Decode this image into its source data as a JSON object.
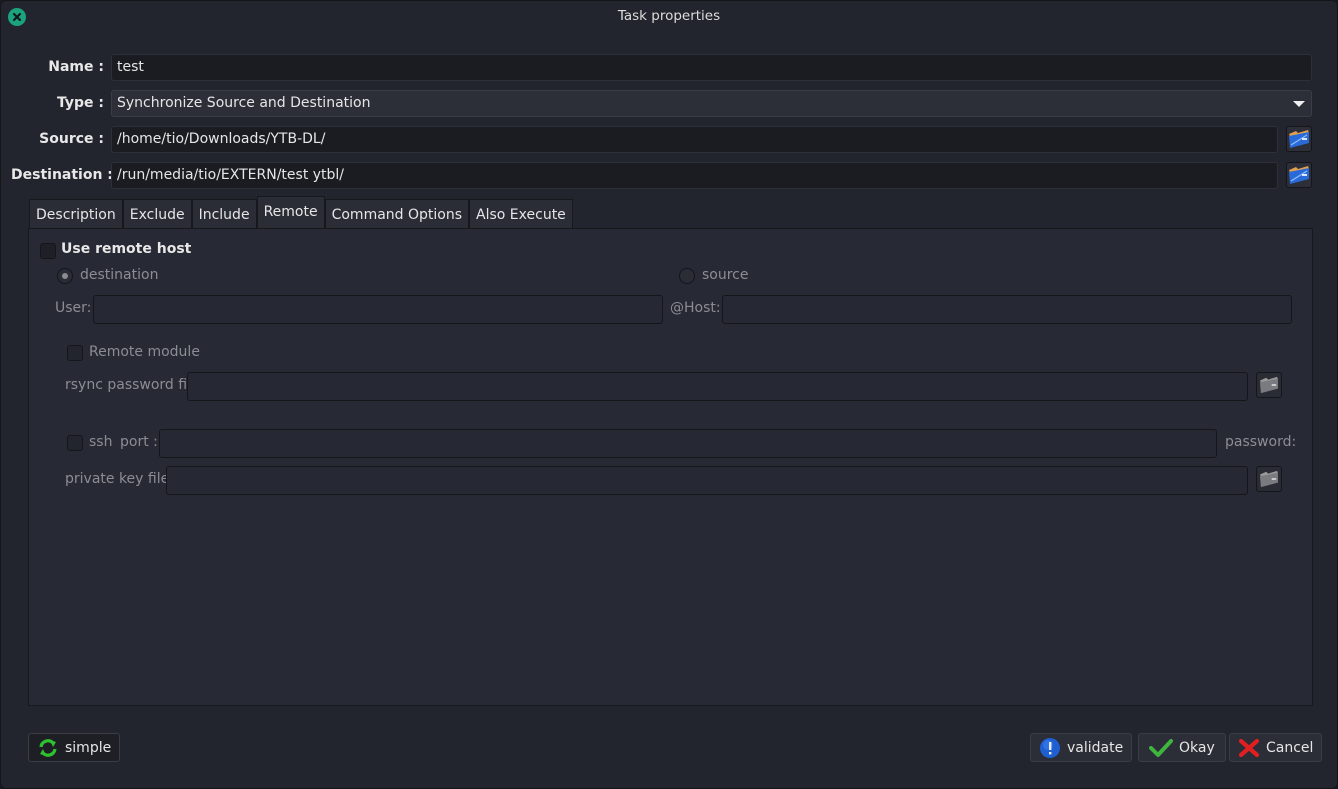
{
  "window": {
    "title": "Task properties",
    "close_icon": "close-icon"
  },
  "form": {
    "name_label": "Name :",
    "name_value": "test",
    "type_label": "Type :",
    "type_value": "Synchronize Source and Destination",
    "source_label": "Source :",
    "source_value": "/home/tio/Downloads/YTB-DL/",
    "destination_label": "Destination :",
    "destination_value": "/run/media/tio/EXTERN/test ytbl/"
  },
  "tabs": [
    {
      "label": "Description",
      "active": false
    },
    {
      "label": "Exclude",
      "active": false
    },
    {
      "label": "Include",
      "active": false
    },
    {
      "label": "Remote",
      "active": true
    },
    {
      "label": "Command Options",
      "active": false
    },
    {
      "label": "Also Execute",
      "active": false
    }
  ],
  "remote": {
    "use_remote_host_label": "Use remote host",
    "use_remote_host_checked": false,
    "radio_destination_label": "destination",
    "radio_destination_selected": true,
    "radio_source_label": "source",
    "radio_source_selected": false,
    "user_label": "User:",
    "user_value": "",
    "host_label": "@Host:",
    "host_value": "",
    "remote_module_label": "Remote module",
    "remote_module_checked": false,
    "rsync_password_file_label": "rsync password file:",
    "rsync_password_file_value": "",
    "ssh_label": "ssh",
    "ssh_checked": false,
    "port_label": "port :",
    "port_value": "",
    "password_label": "password:",
    "private_key_label": "private key file :",
    "private_key_value": ""
  },
  "footer": {
    "simple_label": "simple",
    "validate_label": "validate",
    "okay_label": "Okay",
    "cancel_label": "Cancel"
  },
  "colors": {
    "accent_close": "#1aa37d",
    "background": "#23252e",
    "panel": "#272934"
  }
}
